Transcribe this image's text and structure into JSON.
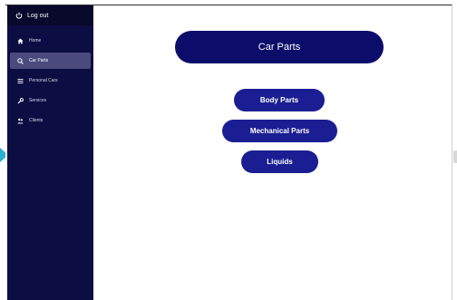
{
  "sidebar": {
    "logout_label": "Log out",
    "items": [
      {
        "label": "Home",
        "icon": "home-icon"
      },
      {
        "label": "Car Parts",
        "icon": "search-icon"
      },
      {
        "label": "Personal Cars",
        "icon": "list-icon"
      },
      {
        "label": "Services",
        "icon": "wrench-icon"
      },
      {
        "label": "Clients",
        "icon": "users-icon"
      }
    ],
    "active_index": 1
  },
  "main": {
    "title": "Car Parts",
    "buttons": {
      "body_parts": "Body Parts",
      "mechanical_parts": "Mechanical Parts",
      "liquids": "Liquids"
    }
  },
  "colors": {
    "sidebar_bg": "#0c0d42",
    "logout_bg": "#08092b",
    "active_item_bg": "#4a4b7c",
    "title_pill_bg": "#0c0d6a",
    "button_bg": "#1a1e92",
    "accent_arrow": "#2bb0cf"
  }
}
